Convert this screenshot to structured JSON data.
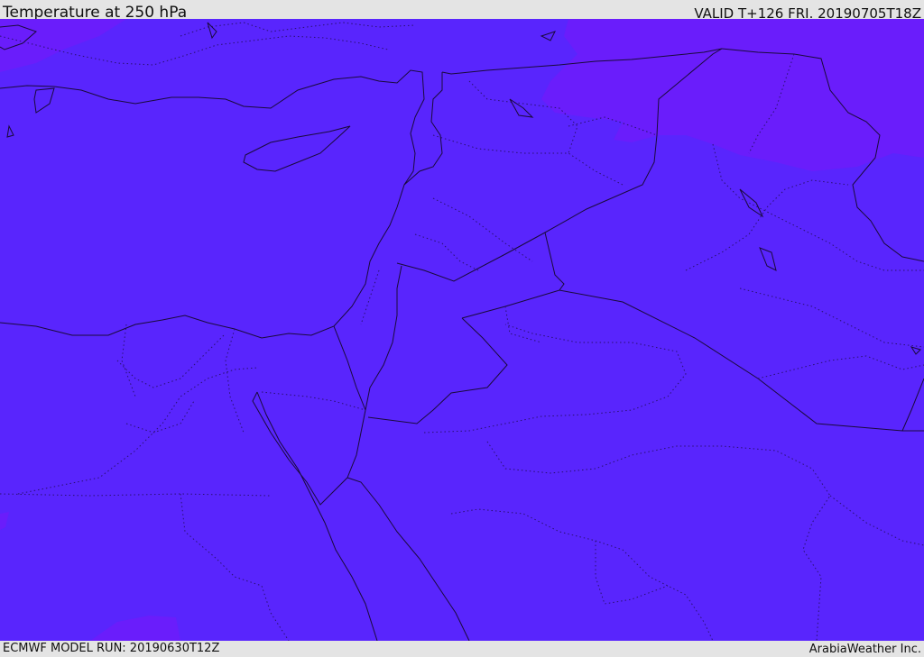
{
  "header": {
    "title": "Temperature at 250 hPa",
    "valid_time": "VALID T+126 FRI. 20190705T18Z"
  },
  "footer": {
    "model_run": "ECMWF MODEL RUN: 20190630T12Z",
    "credit": "ArabiaWeather Inc."
  },
  "map": {
    "colors": {
      "base_field": "#5925fd",
      "cold_field": "#6a1dfb",
      "border_line": "#1a0a3a",
      "province_line": "#2a1070"
    }
  }
}
